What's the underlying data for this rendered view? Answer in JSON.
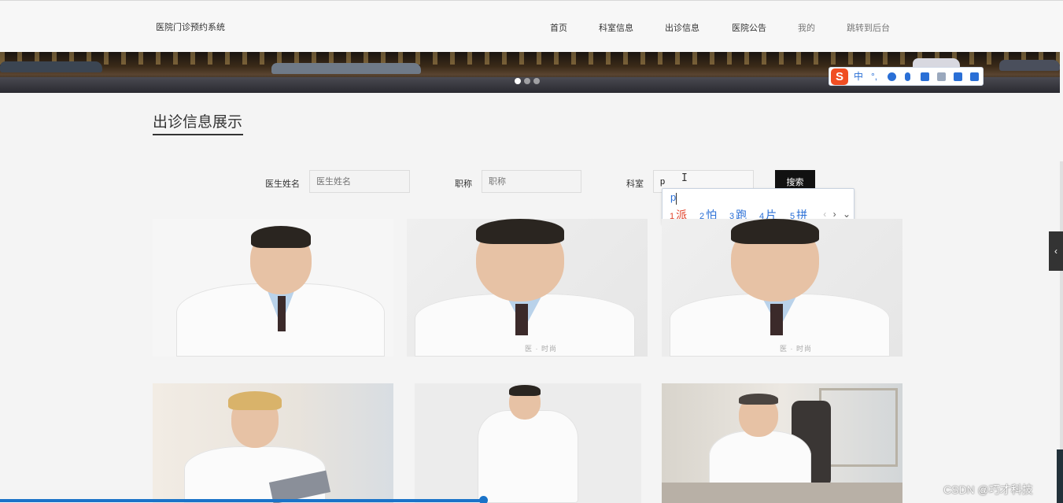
{
  "header": {
    "site_title": "医院门诊预约系统",
    "nav": [
      "首页",
      "科室信息",
      "出诊信息",
      "医院公告",
      "我的",
      "跳转到后台"
    ]
  },
  "banner": {
    "slides": 3,
    "active_slide": 1
  },
  "ime_toolbar": {
    "logo": "S",
    "mode": "中",
    "punct": "°,"
  },
  "section": {
    "title": "出诊信息展示"
  },
  "filters": {
    "doctor_label": "医生姓名",
    "doctor_placeholder": "医生姓名",
    "title_label": "职称",
    "title_placeholder": "职称",
    "dept_label": "科室",
    "dept_value": "p",
    "search_label": "搜索"
  },
  "ime_popup": {
    "typed": "p",
    "candidates": [
      {
        "num": "1",
        "text": "派"
      },
      {
        "num": "2",
        "text": "怕"
      },
      {
        "num": "3",
        "text": "跑"
      },
      {
        "num": "4",
        "text": "片"
      },
      {
        "num": "5",
        "text": "拼"
      }
    ],
    "prev": "‹",
    "next": "›",
    "expand": "⌄"
  },
  "cards": [
    {
      "kind": "male-crossed-arms"
    },
    {
      "kind": "male-portrait"
    },
    {
      "kind": "male-portrait"
    },
    {
      "kind": "female-clipboard"
    },
    {
      "kind": "male-full-body"
    },
    {
      "kind": "senior-desk"
    }
  ],
  "side_tab": {
    "icon": "‹"
  },
  "colors": {
    "accent": "#1a73c8",
    "button": "#111111",
    "ime": "#2a6fd6",
    "ime_highlight": "#e2432b"
  },
  "watermark": "CSDN @巧才科技"
}
